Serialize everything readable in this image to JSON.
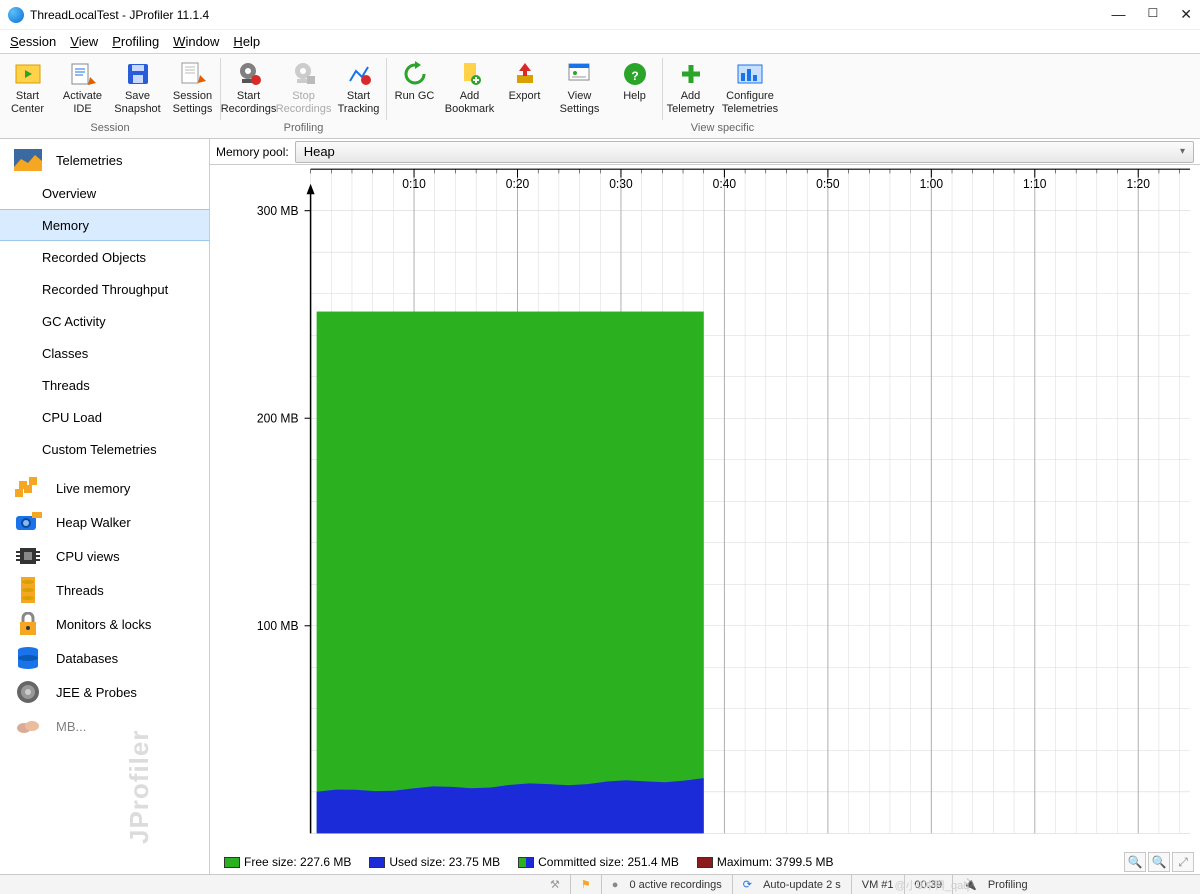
{
  "window": {
    "title": "ThreadLocalTest - JProfiler 11.1.4"
  },
  "menu": {
    "session": "Session",
    "view": "View",
    "profiling": "Profiling",
    "window": "Window",
    "help": "Help"
  },
  "toolbar": {
    "groups": {
      "session": "Session",
      "profiling": "Profiling",
      "viewspec": "View specific"
    },
    "btns": {
      "start_center": "Start\nCenter",
      "activate_ide": "Activate\nIDE",
      "save_snap": "Save\nSnapshot",
      "sess_set": "Session\nSettings",
      "start_rec": "Start\nRecordings",
      "stop_rec": "Stop\nRecordings",
      "start_track": "Start\nTracking",
      "run_gc": "Run GC",
      "add_bm": "Add\nBookmark",
      "export": "Export",
      "view_set": "View\nSettings",
      "help": "Help",
      "add_tel": "Add\nTelemetry",
      "conf_tel": "Configure\nTelemetries"
    }
  },
  "sidebar": {
    "telemetries": "Telemetries",
    "items": [
      "Overview",
      "Memory",
      "Recorded Objects",
      "Recorded Throughput",
      "GC Activity",
      "Classes",
      "Threads",
      "CPU Load",
      "Custom Telemetries"
    ],
    "sections": {
      "live_mem": "Live memory",
      "heap": "Heap Walker",
      "cpu": "CPU views",
      "threads": "Threads",
      "monitors": "Monitors & locks",
      "db": "Databases",
      "jee": "JEE & Probes",
      "mb": "MB..."
    }
  },
  "pool": {
    "label": "Memory pool:",
    "value": "Heap"
  },
  "legend": {
    "free": "Free size: 227.6 MB",
    "used": "Used size: 23.75 MB",
    "comm": "Committed size: 251.4 MB",
    "max": "Maximum: 3799.5 MB"
  },
  "status": {
    "rec": "0 active recordings",
    "auto": "Auto-update 2 s",
    "vm": "VM #1",
    "time": "00:39",
    "prof": "Profiling",
    "mask": "@小9冲鸭_qaq"
  },
  "chart_data": {
    "type": "area",
    "xlabel": "",
    "ylabel": "",
    "xlim_seconds": [
      0,
      85
    ],
    "ylim": [
      0,
      320
    ],
    "y_ticks": [
      100,
      200,
      300
    ],
    "y_tick_labels": [
      "100 MB",
      "200 MB",
      "300 MB"
    ],
    "x_ticks_seconds": [
      10,
      20,
      30,
      40,
      50,
      60,
      70,
      80
    ],
    "x_tick_labels": [
      "0:10",
      "0:20",
      "0:30",
      "0:40",
      "0:50",
      "1:00",
      "1:10",
      "1:20"
    ],
    "data_end_seconds": 38,
    "series": [
      {
        "name": "Committed",
        "color": "#2bb120",
        "values_mb": 251.4
      },
      {
        "name": "Used",
        "color": "#1b2bd8",
        "values_start_mb": 20,
        "values_end_mb": 26
      }
    ],
    "colors": {
      "free": "#2bb120",
      "used": "#1b2bd8",
      "committed_box": "#2bb120",
      "max": "#8c1b1b"
    }
  }
}
